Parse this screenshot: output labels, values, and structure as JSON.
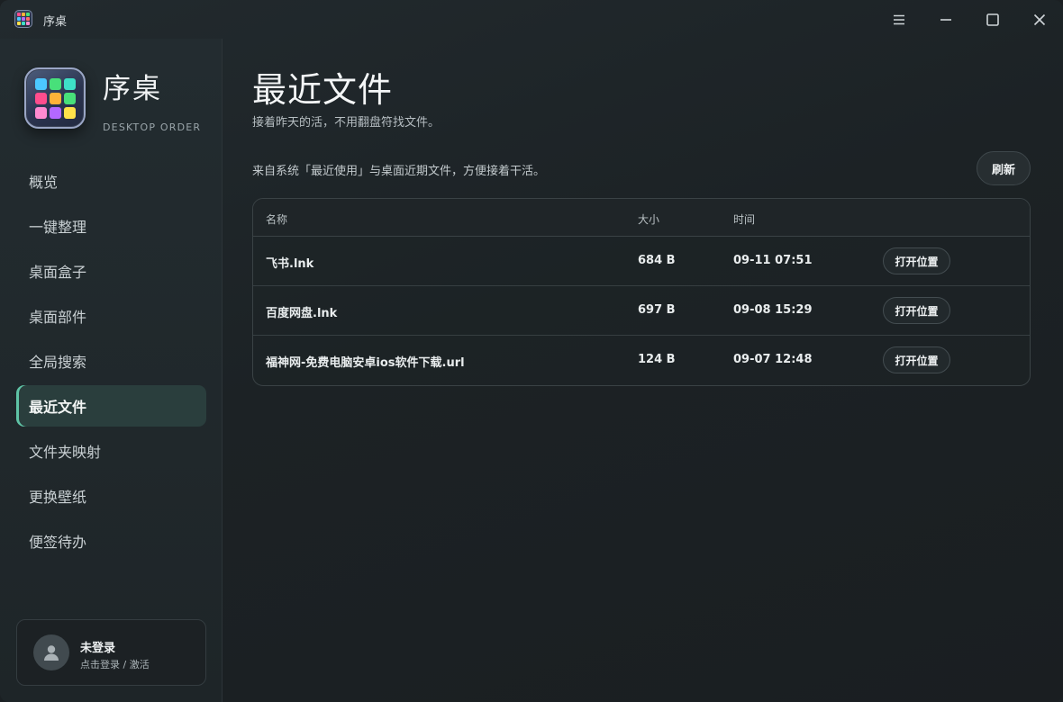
{
  "window": {
    "title": "序桌"
  },
  "sidebar": {
    "brand_name": "序桌",
    "brand_sub": "DESKTOP ORDER",
    "items": [
      {
        "label": "概览"
      },
      {
        "label": "一键整理"
      },
      {
        "label": "桌面盒子"
      },
      {
        "label": "桌面部件"
      },
      {
        "label": "全局搜索"
      },
      {
        "label": "最近文件",
        "active": true
      },
      {
        "label": "文件夹映射"
      },
      {
        "label": "更换壁纸"
      },
      {
        "label": "便签待办"
      }
    ],
    "user": {
      "name": "未登录",
      "sub": "点击登录 / 激活"
    }
  },
  "main": {
    "title": "最近文件",
    "subtitle": "接着昨天的活，不用翻盘符找文件。",
    "info": "来自系统「最近使用」与桌面近期文件，方便接着干活。",
    "refresh_label": "刷新",
    "table": {
      "headers": {
        "name": "名称",
        "size": "大小",
        "time": "时间"
      },
      "rows": [
        {
          "name": "飞书.lnk",
          "size": "684 B",
          "time": "09-11 07:51",
          "action": "打开位置"
        },
        {
          "name": "百度网盘.lnk",
          "size": "697 B",
          "time": "09-08 15:29",
          "action": "打开位置"
        },
        {
          "name": "福神网-免费电脑安卓ios软件下载.url",
          "size": "124 B",
          "time": "09-07 12:48",
          "action": "打开位置"
        }
      ]
    }
  },
  "colors": {
    "accent": "#5fc3a6",
    "background": "#1c2225",
    "sidebar": "#232c30",
    "active_item": "#2a3e3d",
    "logo_tiles": [
      "#ff4d8d",
      "#ffb238",
      "#48e07a",
      "#4cc8ff",
      "#b368ff",
      "#ff6b6b",
      "#ffe14a",
      "#3ee0c8",
      "#ff8ad1"
    ]
  },
  "icons": {
    "app": "app-grid-icon",
    "menu": "hamburger-menu-icon",
    "minimize": "minimize-icon",
    "maximize": "maximize-icon",
    "close": "close-icon",
    "avatar": "user-avatar-icon"
  }
}
